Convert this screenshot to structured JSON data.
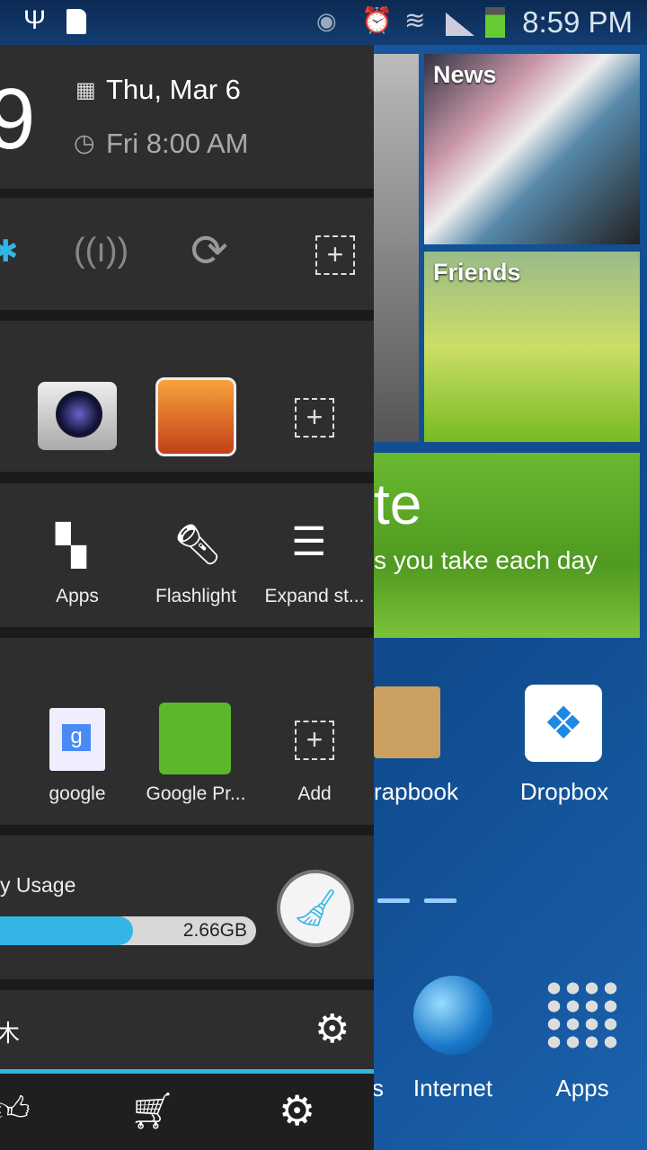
{
  "status_bar": {
    "time": "8:59 PM",
    "icons": [
      "usb-icon",
      "sim-card-icon",
      "smart-stay-eye-icon",
      "alarm-icon",
      "wifi-icon",
      "signal-icon",
      "battery-charging-icon"
    ]
  },
  "clock": {
    "hour_fragment": "9",
    "date": "Thu, Mar 6",
    "alarm": "Fri 8:00 AM"
  },
  "toggles": [
    "bluetooth-icon",
    "hotspot-icon",
    "sync-icon",
    "add-icon"
  ],
  "app_shortcuts": [
    {
      "name": "Camera"
    },
    {
      "name": "Clash of Clans"
    },
    {
      "name": "Add",
      "icon": "add-icon"
    }
  ],
  "actions": [
    {
      "label": "Apps"
    },
    {
      "label": "Flashlight"
    },
    {
      "label": "Expand st..."
    }
  ],
  "shortcuts": [
    {
      "label": "google"
    },
    {
      "label": "Google Pr..."
    },
    {
      "label": "Add"
    }
  ],
  "memory": {
    "label": "y Usage",
    "value": "2.66GB",
    "used_fraction": 0.52,
    "accent": "#33b5e5"
  },
  "profile_row": {
    "text": "木"
  },
  "bottom_bar": [
    "thumbs-up-icon",
    "cart-icon",
    "settings-icon"
  ],
  "home": {
    "tiles": [
      {
        "label": "News"
      },
      {
        "label": "Friends"
      }
    ],
    "banner": {
      "title_fragment": "te",
      "subtitle_fragment": "s you take each day"
    },
    "icons": [
      {
        "label": "rapbook"
      },
      {
        "label": "Dropbox"
      }
    ],
    "dock": [
      {
        "label": "s"
      },
      {
        "label": "Internet"
      },
      {
        "label": "Apps"
      }
    ]
  }
}
